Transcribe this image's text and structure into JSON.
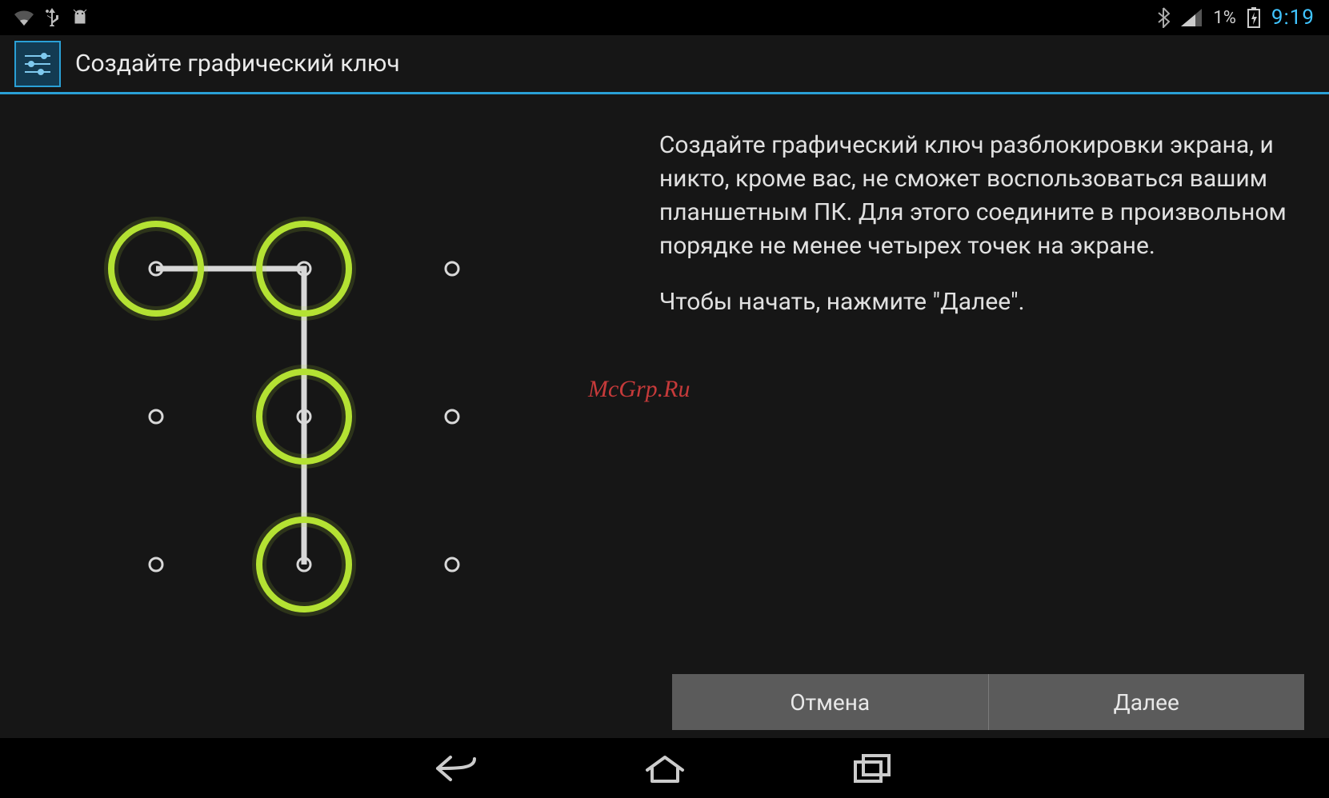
{
  "status": {
    "battery_percent": "1%",
    "clock": "9:19"
  },
  "header": {
    "title": "Создайте графический ключ"
  },
  "instructions": {
    "paragraph1": "Создайте графический ключ разблокировки экрана, и никто, кроме вас, не сможет воспользоваться вашим планшетным ПК. Для этого соедините в произвольном порядке не менее четырех точек на экране.",
    "paragraph2": "Чтобы начать, нажмите \"Далее\"."
  },
  "watermark": "McGrp.Ru",
  "buttons": {
    "cancel": "Отмена",
    "next": "Далее"
  },
  "pattern": {
    "grid_size": 3,
    "selected_path": [
      0,
      1,
      4,
      7
    ],
    "accent_color": "#b4e233"
  }
}
